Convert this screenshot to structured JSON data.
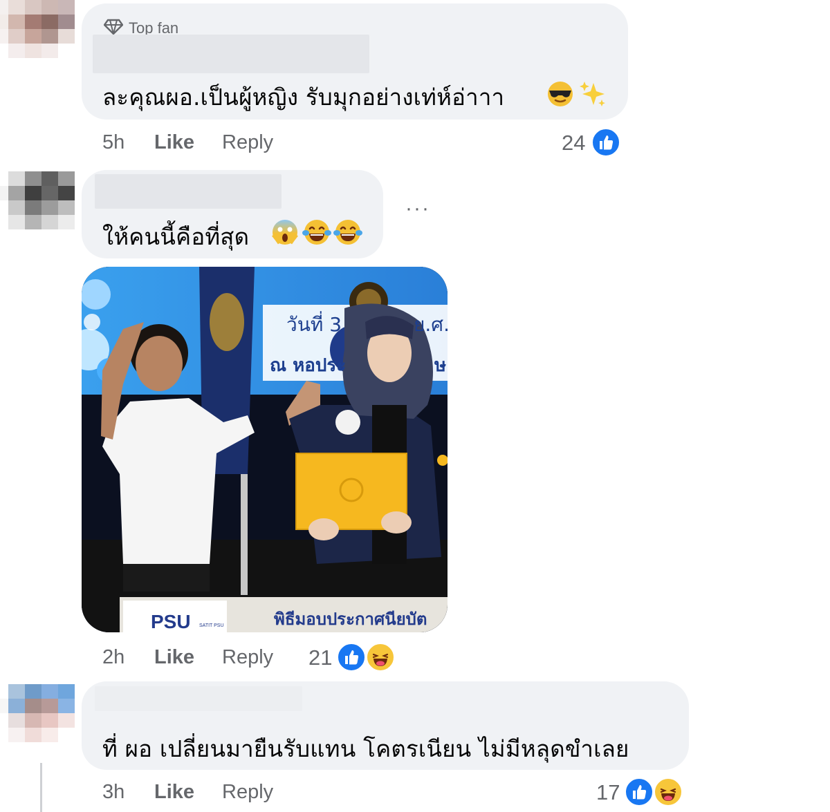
{
  "comments": [
    {
      "badge": "Top fan",
      "text": "ละคุณผอ.เป็นผู้หญิง รับมุกอย่างเท่ห์อ่าาา",
      "emojis": [
        "smiling-face-with-sunglasses",
        "sparkles"
      ],
      "time": "5h",
      "like_label": "Like",
      "reply_label": "Reply",
      "reaction_count": "24",
      "reactions": [
        "like"
      ]
    },
    {
      "text": "ให้คนนี้คือที่สุด",
      "emojis": [
        "face-screaming-in-fear",
        "face-with-tears-of-joy",
        "face-with-tears-of-joy"
      ],
      "more_label": "···",
      "photo": {
        "banner_date": "วันที่ 3",
        "banner_date_suffix": "ย.ศ.",
        "banner_venue": "ณ หอประ",
        "banner_venue_suffix": "ษ",
        "podium_logo": "PSU",
        "podium_logo_small": "SATIT PSU",
        "podium_text": "พิธีมอบประกาศนียบัต"
      },
      "time": "2h",
      "like_label": "Like",
      "reply_label": "Reply",
      "reaction_count": "21",
      "reactions": [
        "like",
        "haha"
      ]
    },
    {
      "text": "ที่ ผอ เปลี่ยนมายืนรับแทน โคตรเนียน ไม่มีหลุดขำเลย",
      "time": "3h",
      "like_label": "Like",
      "reply_label": "Reply",
      "reaction_count": "17",
      "reactions": [
        "like",
        "haha"
      ]
    }
  ],
  "colors": {
    "bubble": "#f0f2f5",
    "meta_text": "#65676b",
    "like_blue": "#1877f2",
    "haha_yellow": "#f7c63a"
  }
}
